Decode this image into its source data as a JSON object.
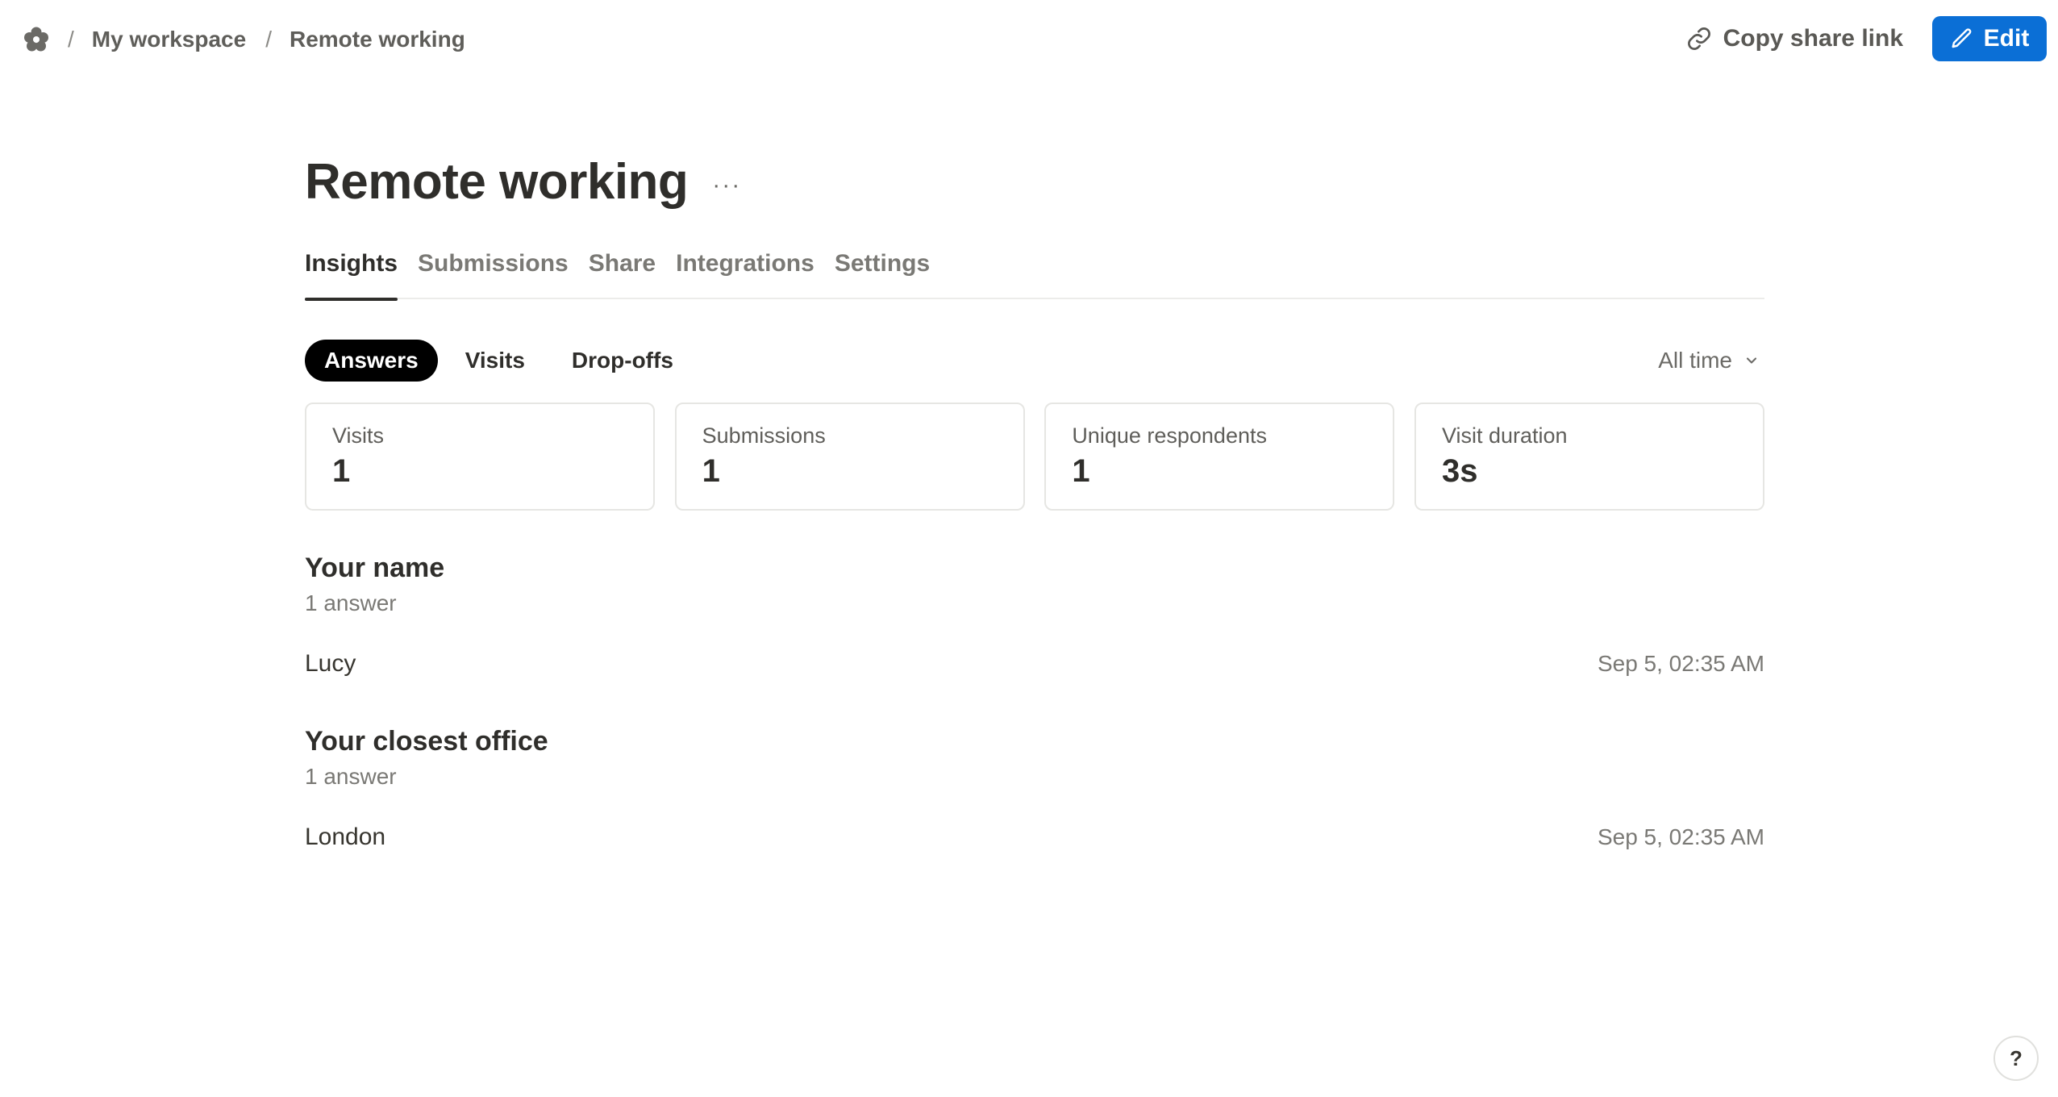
{
  "breadcrumb": {
    "logo_icon": "flower-logo-icon",
    "separator": "/",
    "items": [
      "My workspace",
      "Remote working"
    ]
  },
  "actions": {
    "copy_share_link": "Copy share link",
    "edit": "Edit"
  },
  "page": {
    "title": "Remote working",
    "more": "···"
  },
  "tabs": [
    {
      "label": "Insights",
      "active": true
    },
    {
      "label": "Submissions"
    },
    {
      "label": "Share"
    },
    {
      "label": "Integrations"
    },
    {
      "label": "Settings"
    }
  ],
  "subtabs": [
    {
      "label": "Answers",
      "active": true
    },
    {
      "label": "Visits"
    },
    {
      "label": "Drop-offs"
    }
  ],
  "range": {
    "label": "All time"
  },
  "stats": [
    {
      "label": "Visits",
      "value": "1"
    },
    {
      "label": "Submissions",
      "value": "1"
    },
    {
      "label": "Unique respondents",
      "value": "1"
    },
    {
      "label": "Visit duration",
      "value": "3s"
    }
  ],
  "questions": [
    {
      "title": "Your name",
      "count": "1 answer",
      "answer": "Lucy",
      "time": "Sep 5, 02:35 AM"
    },
    {
      "title": "Your closest office",
      "count": "1 answer",
      "answer": "London",
      "time": "Sep 5, 02:35 AM"
    }
  ],
  "help": {
    "label": "?"
  },
  "colors": {
    "accent": "#0b6fd6",
    "pill_active": "#000000"
  }
}
